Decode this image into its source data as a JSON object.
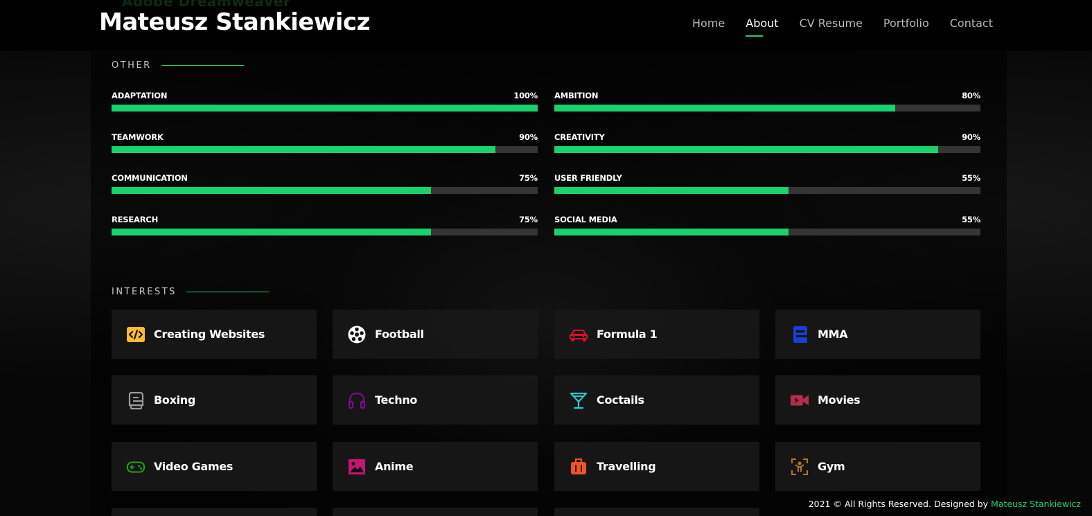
{
  "header": {
    "faint_title": "Adobe Dreamweaver",
    "brand": "Mateusz Stankiewicz",
    "nav": [
      "Home",
      "About",
      "CV Resume",
      "Portfolio",
      "Contact"
    ],
    "active_nav": "About"
  },
  "skills_section": {
    "title": "OTHER",
    "items": [
      {
        "label": "ADAPTATION",
        "value": "100%",
        "percent": 100
      },
      {
        "label": "AMBITION",
        "value": "80%",
        "percent": 80
      },
      {
        "label": "TEAMWORK",
        "value": "90%",
        "percent": 90
      },
      {
        "label": "CREATIVITY",
        "value": "90%",
        "percent": 90
      },
      {
        "label": "COMMUNICATION",
        "value": "75%",
        "percent": 75
      },
      {
        "label": "USER FRIENDLY",
        "value": "55%",
        "percent": 55
      },
      {
        "label": "RESEARCH",
        "value": "75%",
        "percent": 75
      },
      {
        "label": "SOCIAL MEDIA",
        "value": "55%",
        "percent": 55
      }
    ]
  },
  "interests_section": {
    "title": "INTERESTS",
    "items": [
      {
        "label": "Creating Websites",
        "icon": "code-icon",
        "color": "#ffbb2c"
      },
      {
        "label": "Football",
        "icon": "football-icon",
        "color": "#ffffff"
      },
      {
        "label": "Formula 1",
        "icon": "car-icon",
        "color": "#e80368"
      },
      {
        "label": "MMA",
        "icon": "boxing-glove-icon",
        "color": "#1c3fd1"
      },
      {
        "label": "Boxing",
        "icon": "glove-icon",
        "color": "#9b9b9b"
      },
      {
        "label": "Techno",
        "icon": "headphones-icon",
        "color": "#7d0e8f"
      },
      {
        "label": "Coctails",
        "icon": "cocktail-icon",
        "color": "#29cccc"
      },
      {
        "label": "Movies",
        "icon": "video-camera-icon",
        "color": "#b2304e"
      },
      {
        "label": "Video Games",
        "icon": "gamepad-icon",
        "color": "#1fa31f"
      },
      {
        "label": "Anime",
        "icon": "image-icon",
        "color": "#c5166f"
      },
      {
        "label": "Travelling",
        "icon": "suitcase-icon",
        "color": "#f05422"
      },
      {
        "label": "Gym",
        "icon": "gym-icon",
        "color": "#b4752a"
      }
    ]
  },
  "footer": {
    "text": "2021 © All Rights Reserved. Designed by",
    "author": "Mateusz Stankiewicz"
  },
  "colors": {
    "accent": "#18d26e",
    "track": "#353535",
    "card": "#181818"
  }
}
